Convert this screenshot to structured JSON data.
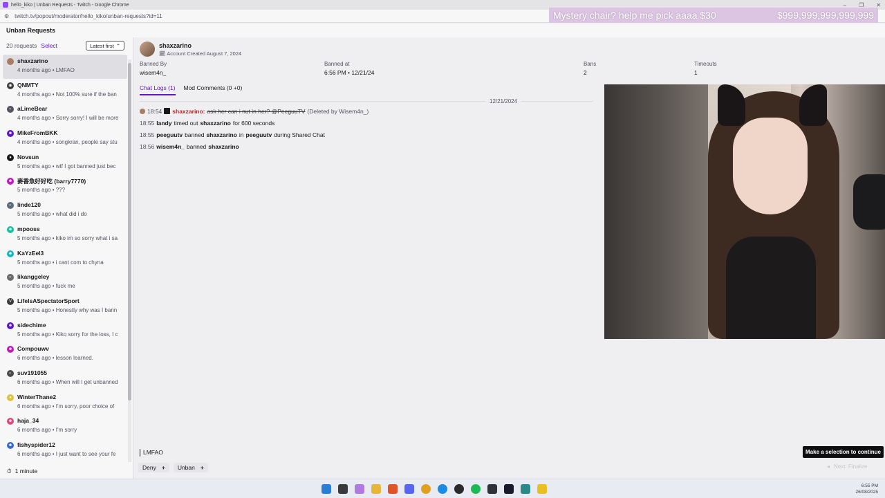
{
  "window": {
    "title": "hello_kiko | Unban Requests - Twitch - Google Chrome",
    "url": "twitch.tv/popout/moderator/hello_kiko/unban-requests?id=11",
    "controls": [
      "–",
      "❐",
      "✕"
    ]
  },
  "overlay": {
    "goal_text": "Mystery chair? help me pick aaaa $30",
    "goal_amount": "$999,999,999,999,999"
  },
  "header": {
    "title": "Unban Requests"
  },
  "sidebar": {
    "count": "20 requests",
    "select_label": "Select",
    "sort_label": "Latest first",
    "sort_icon": "⌃",
    "requests": [
      {
        "name": "shaxzarino",
        "meta": "4 months ago • LMFAO",
        "color": "#a87d63",
        "icon": ""
      },
      {
        "name": "QNMTY",
        "meta": "4 months ago • Not 100% sure if the ban",
        "color": "#3a3a3d",
        "icon": "◉"
      },
      {
        "name": "aLimeBear",
        "meta": "4 months ago • Sorry sorry! I will be more",
        "color": "#53535f",
        "icon": "◐"
      },
      {
        "name": "MikeFromBKK",
        "meta": "4 months ago • songkran, people say stu",
        "color": "#5c16c5",
        "icon": "☻"
      },
      {
        "name": "Novsun",
        "meta": "5 months ago • wtf I got banned just bec",
        "color": "#18181b",
        "icon": "●"
      },
      {
        "name": "麥香魚好好吃 (barry7770)",
        "meta": "5 months ago • ???",
        "color": "#c219c2",
        "icon": "☻"
      },
      {
        "name": "linde120",
        "meta": "5 months ago • what did i do",
        "color": "#5a6a7a",
        "icon": "◐"
      },
      {
        "name": "mpooss",
        "meta": "5 months ago • kiko im so sorry what i sa",
        "color": "#19c2a0",
        "icon": "☻"
      },
      {
        "name": "KaYzEel3",
        "meta": "5 months ago • i cant com to chyna",
        "color": "#19b5c2",
        "icon": "☻"
      },
      {
        "name": "likanggeley",
        "meta": "5 months ago • fuck me",
        "color": "#6a6a6a",
        "icon": "◐"
      },
      {
        "name": "LifeIsASpectatorSport",
        "meta": "5 months ago • Honestly why was I bann",
        "color": "#3a3a3d",
        "icon": "V"
      },
      {
        "name": "sidechime",
        "meta": "5 months ago • Kiko sorry for the loss, I c",
        "color": "#5c16c5",
        "icon": "☻"
      },
      {
        "name": "Compouwv",
        "meta": "6 months ago • lesson learned.",
        "color": "#c219c2",
        "icon": "☻"
      },
      {
        "name": "suv191055",
        "meta": "6 months ago • When will I get unbanned",
        "color": "#4a4a4a",
        "icon": "◐"
      },
      {
        "name": "WinterThane2",
        "meta": "6 months ago • I'm sorry, poor choice of",
        "color": "#e0c040",
        "icon": "●"
      },
      {
        "name": "haja_34",
        "meta": "6 months ago • I'm sorry",
        "color": "#e0487a",
        "icon": "☻"
      },
      {
        "name": "fishyspider12",
        "meta": "6 months ago • I just want to see your fe",
        "color": "#3a6ad0",
        "icon": "☻"
      }
    ],
    "footer": {
      "icon": "⏱",
      "label": "1 minute"
    }
  },
  "user": {
    "name": "shaxzarino",
    "created_icon": "🗓",
    "created": "Account Created August 7, 2024"
  },
  "stats": {
    "banned_by_label": "Banned By",
    "banned_by": "wisem4n_",
    "banned_at_label": "Banned at",
    "banned_at": "6:56 PM • 12/21/24",
    "bans_label": "Bans",
    "bans": "2",
    "timeouts_label": "Timeouts",
    "timeouts": "1"
  },
  "tabs": {
    "chat_logs": "Chat Logs (1)",
    "mod_comments": "Mod Comments (0 +0)"
  },
  "logs": {
    "date": "12/21/2024",
    "row1": {
      "time": "18:54",
      "user": "shaxzarino:",
      "msg": "ask her can i nut in her? @PeeguuTV",
      "deleted": "(Deleted by Wisem4n_)"
    },
    "row2": {
      "time": "18:55",
      "actor": "landy",
      "mid": "timed out",
      "target": "shaxzarino",
      "tail": "for 600 seconds"
    },
    "row3": {
      "time": "18:55",
      "actor": "peeguutv",
      "mid": "banned",
      "target": "shaxzarino",
      "in": "in",
      "chan": "peeguutv",
      "tail": "during Shared Chat"
    },
    "row4": {
      "time": "18:56",
      "actor": "wisem4n_",
      "mid": "banned",
      "target": "shaxzarino"
    }
  },
  "input": {
    "value": "LMFAO"
  },
  "actions": {
    "deny": "Deny",
    "unban": "Unban",
    "plus": "+"
  },
  "tooltip": "Make a selection to continue",
  "next": {
    "arrow": "◂",
    "label": "Next: Finalize"
  },
  "taskbar": {
    "time": "6:55 PM",
    "date": "26/08/2025"
  }
}
